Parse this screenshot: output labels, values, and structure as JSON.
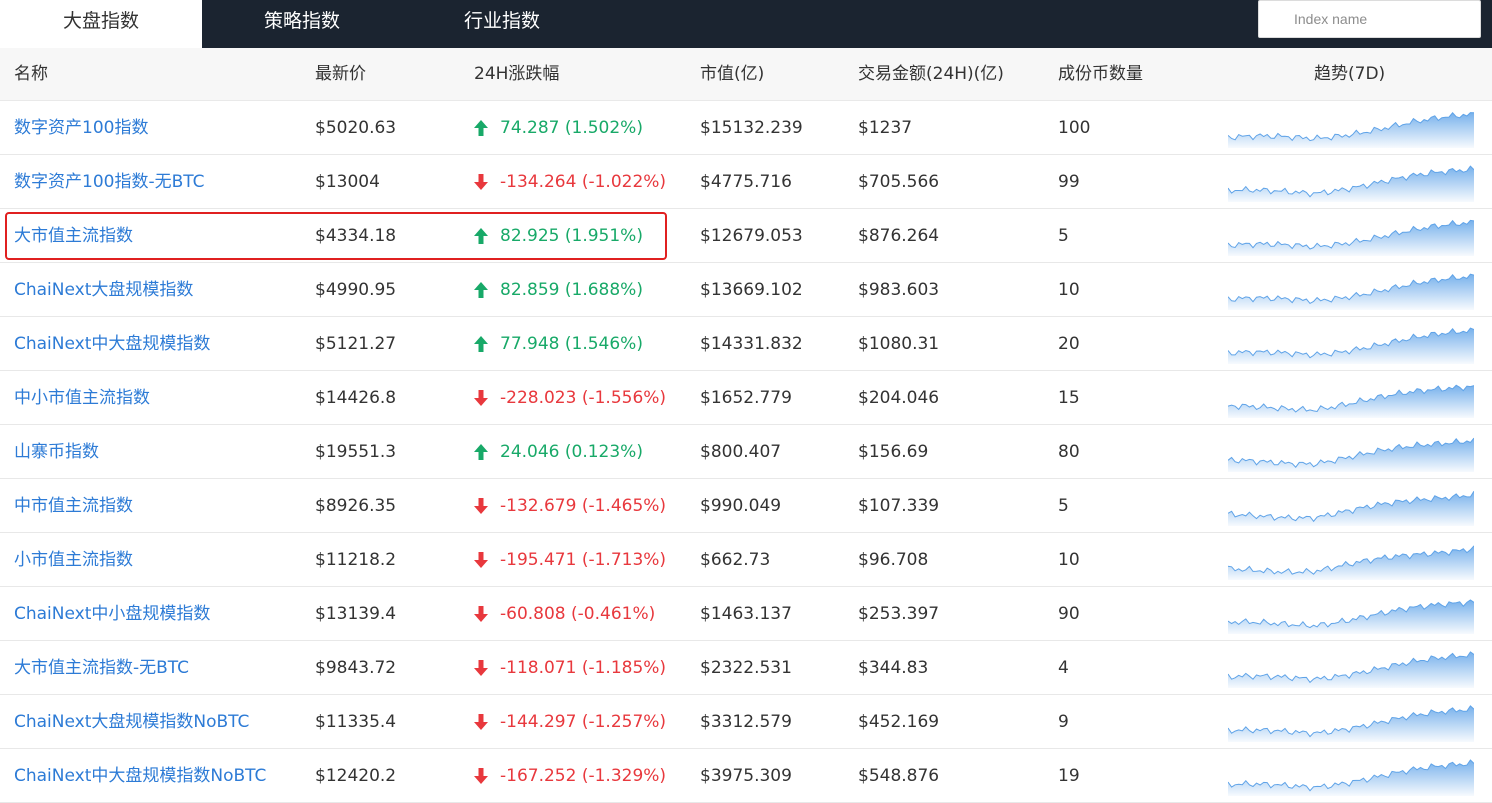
{
  "tabs": [
    "大盘指数",
    "策略指数",
    "行业指数"
  ],
  "search": {
    "placeholder": "Index name",
    "value": ""
  },
  "columns": [
    "名称",
    "最新价",
    "24H涨跌幅",
    "市值(亿)",
    "交易金额(24H)(亿)",
    "成份币数量",
    "趋势(7D)"
  ],
  "colors": {
    "up": "#18a968",
    "down": "#e8383d",
    "link": "#2d7bd6",
    "header_bg": "#1b2430",
    "highlight": "#e02020",
    "sparkline": "#5fa3e8"
  },
  "highlighted_row": 2,
  "rows": [
    {
      "name": "数字资产100指数",
      "price": "$5020.63",
      "change": "74.287 (1.502%)",
      "direction": "up",
      "cap": "$15132.239",
      "volume": "$1237",
      "count": "100"
    },
    {
      "name": "数字资产100指数-无BTC",
      "price": "$13004",
      "change": "-134.264 (-1.022%)",
      "direction": "down",
      "cap": "$4775.716",
      "volume": "$705.566",
      "count": "99"
    },
    {
      "name": "大市值主流指数",
      "price": "$4334.18",
      "change": "82.925 (1.951%)",
      "direction": "up",
      "cap": "$12679.053",
      "volume": "$876.264",
      "count": "5"
    },
    {
      "name": "ChaiNext大盘规模指数",
      "price": "$4990.95",
      "change": "82.859 (1.688%)",
      "direction": "up",
      "cap": "$13669.102",
      "volume": "$983.603",
      "count": "10"
    },
    {
      "name": "ChaiNext中大盘规模指数",
      "price": "$5121.27",
      "change": "77.948 (1.546%)",
      "direction": "up",
      "cap": "$14331.832",
      "volume": "$1080.31",
      "count": "20"
    },
    {
      "name": "中小市值主流指数",
      "price": "$14426.8",
      "change": "-228.023 (-1.556%)",
      "direction": "down",
      "cap": "$1652.779",
      "volume": "$204.046",
      "count": "15"
    },
    {
      "name": "山寨币指数",
      "price": "$19551.3",
      "change": "24.046 (0.123%)",
      "direction": "up",
      "cap": "$800.407",
      "volume": "$156.69",
      "count": "80"
    },
    {
      "name": "中市值主流指数",
      "price": "$8926.35",
      "change": "-132.679 (-1.465%)",
      "direction": "down",
      "cap": "$990.049",
      "volume": "$107.339",
      "count": "5"
    },
    {
      "name": "小市值主流指数",
      "price": "$11218.2",
      "change": "-195.471 (-1.713%)",
      "direction": "down",
      "cap": "$662.73",
      "volume": "$96.708",
      "count": "10"
    },
    {
      "name": "ChaiNext中小盘规模指数",
      "price": "$13139.4",
      "change": "-60.808 (-0.461%)",
      "direction": "down",
      "cap": "$1463.137",
      "volume": "$253.397",
      "count": "90"
    },
    {
      "name": "大市值主流指数-无BTC",
      "price": "$9843.72",
      "change": "-118.071 (-1.185%)",
      "direction": "down",
      "cap": "$2322.531",
      "volume": "$344.83",
      "count": "4"
    },
    {
      "name": "ChaiNext大盘规模指数NoBTC",
      "price": "$11335.4",
      "change": "-144.297 (-1.257%)",
      "direction": "down",
      "cap": "$3312.579",
      "volume": "$452.169",
      "count": "9"
    },
    {
      "name": "ChaiNext中大盘规模指数NoBTC",
      "price": "$12420.2",
      "change": "-167.252 (-1.329%)",
      "direction": "down",
      "cap": "$3975.309",
      "volume": "$548.876",
      "count": "19"
    }
  ]
}
